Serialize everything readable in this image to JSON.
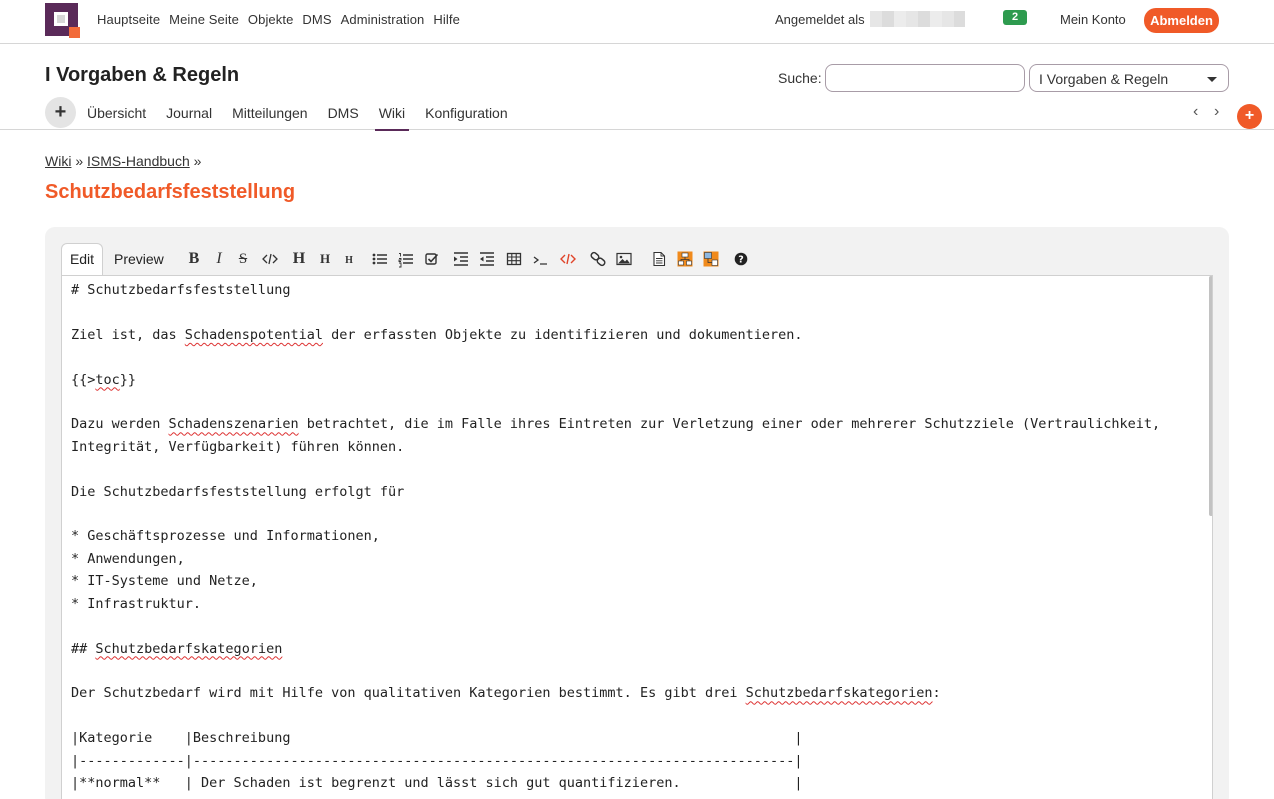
{
  "topbar": {
    "nav": [
      "Hauptseite",
      "Meine Seite",
      "Objekte",
      "DMS",
      "Administration",
      "Hilfe"
    ],
    "login_label": "Angemeldet als",
    "notification_count": "2",
    "account_label": "Mein Konto",
    "logout_label": "Abmelden"
  },
  "header": {
    "project_title": "I Vorgaben & Regeln",
    "search_label": "Suche:",
    "search_value": "",
    "project_select_value": "I Vorgaben & Regeln"
  },
  "tabs": {
    "plus_symbol": "+",
    "items": [
      "Übersicht",
      "Journal",
      "Mitteilungen",
      "DMS",
      "Wiki",
      "Konfiguration"
    ],
    "active": "Wiki",
    "prev_symbol": "‹",
    "next_symbol": "›",
    "add_symbol": "+"
  },
  "breadcrumb": {
    "items": [
      "Wiki",
      "ISMS-Handbuch"
    ],
    "separator": "»"
  },
  "page_title": "Schutzbedarfsfeststellung",
  "editor": {
    "edit_tab": "Edit",
    "preview_tab": "Preview",
    "toolbar": [
      "bold-icon",
      "italic-icon",
      "strikethrough-icon",
      "inline-code-icon",
      "heading1-icon",
      "heading2-icon",
      "heading3-icon",
      "bullet-list-icon",
      "numbered-list-icon",
      "task-list-icon",
      "indent-icon",
      "outdent-icon",
      "table-icon",
      "code-block-icon",
      "html-code-icon",
      "link-icon",
      "image-icon",
      "document-icon",
      "diagram-icon",
      "diagram2-icon",
      "help-icon"
    ],
    "lines": [
      "# Schutzbedarfsfeststellung",
      "",
      "Ziel ist, das Schadenspotential der erfassten Objekte zu identifizieren und dokumentieren.",
      "",
      "{{>toc}}",
      "",
      "Dazu werden Schadenszenarien betrachtet, die im Falle ihres Eintreten zur Verletzung einer oder mehrerer Schutzziele (Vertraulichkeit,",
      "Integrität, Verfügbarkeit) führen können.",
      "",
      "Die Schutzbedarfsfeststellung erfolgt für",
      "",
      "* Geschäftsprozesse und Informationen,",
      "* Anwendungen,",
      "* IT-Systeme und Netze,",
      "* Infrastruktur.",
      "",
      "## Schutzbedarfskategorien",
      "",
      "Der Schutzbedarf wird mit Hilfe von qualitativen Kategorien bestimmt. Es gibt drei Schutzbedarfskategorien:",
      "",
      "|Kategorie    |Beschreibung                                                              |",
      "|-------------|--------------------------------------------------------------------------|",
      "|**normal**   | Der Schaden ist begrenzt und lässt sich gut quantifizieren.              |"
    ],
    "spellcheck_words": [
      "Schadenspotential",
      "toc",
      "Schadenszenarien",
      "Schutzbedarfskategorien"
    ]
  }
}
